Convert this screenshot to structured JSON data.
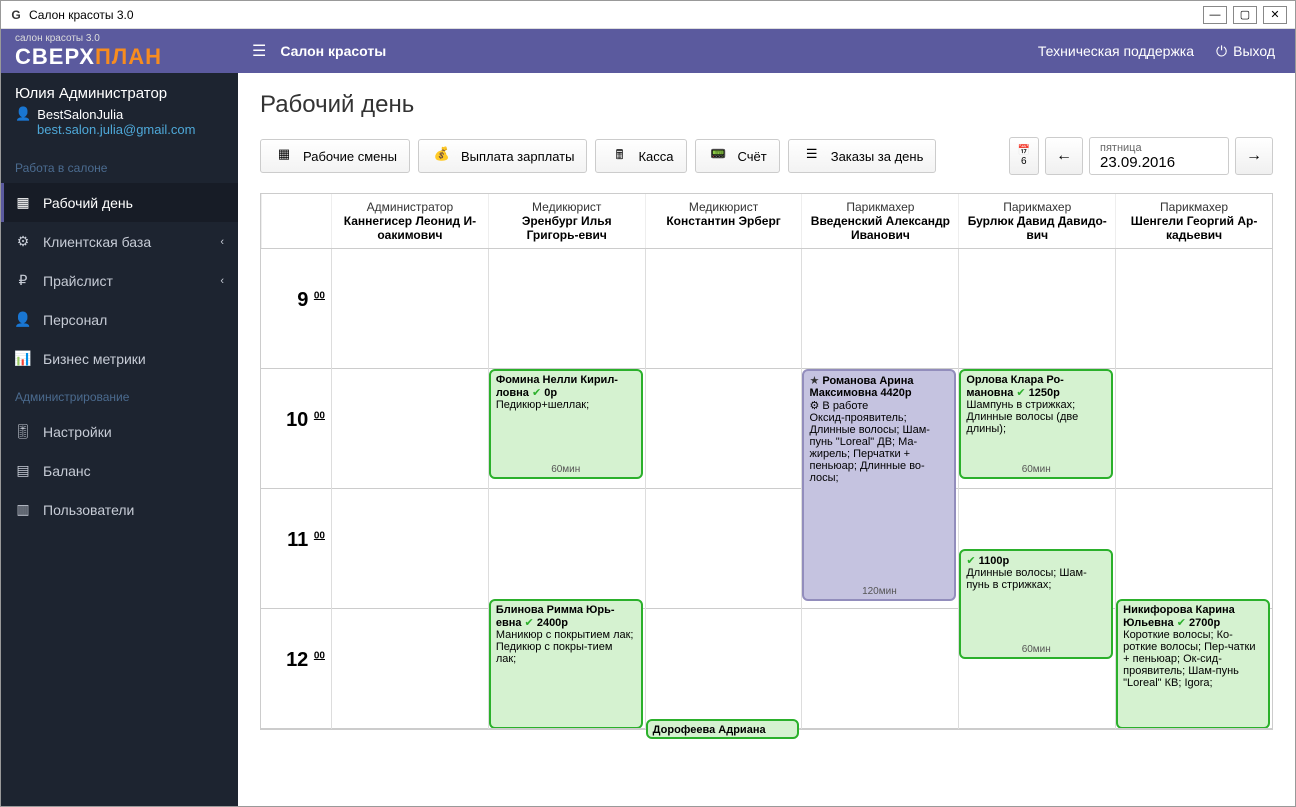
{
  "window": {
    "title": "Салон красоты 3.0"
  },
  "topbar": {
    "logo_top": "салон красоты 3.0",
    "logo_a": "СВЕРХ",
    "logo_b": "ПЛАН",
    "title": "Салон красоты",
    "support": "Техническая поддержка",
    "logout": "Выход"
  },
  "user": {
    "name": "Юлия Администратор",
    "salon": "BestSalonJulia",
    "email": "best.salon.julia@gmail.com"
  },
  "sidebar": {
    "section1": "Работа в салоне",
    "section2": "Администрирование",
    "items": [
      {
        "label": "Рабочий день"
      },
      {
        "label": "Клиентская база"
      },
      {
        "label": "Прайслист"
      },
      {
        "label": "Персонал"
      },
      {
        "label": "Бизнес метрики"
      },
      {
        "label": "Настройки"
      },
      {
        "label": "Баланс"
      },
      {
        "label": "Пользователи"
      }
    ]
  },
  "page": {
    "title": "Рабочий день"
  },
  "toolbar": {
    "shifts": "Рабочие смены",
    "payroll": "Выплата зарплаты",
    "cashier": "Касса",
    "invoice": "Счёт",
    "orders": "Заказы за день"
  },
  "date": {
    "day": "6",
    "dow": "пятница",
    "value": "23.09.2016"
  },
  "staff": [
    {
      "role": "Администратор",
      "name": "Каннегисер Леонид И-оакимович"
    },
    {
      "role": "Медикюрист",
      "name": "Эренбург Илья Григорь-евич"
    },
    {
      "role": "Медикюрист",
      "name": "Константин Эрберг"
    },
    {
      "role": "Парикмахер",
      "name": "Введенский Александр Иванович"
    },
    {
      "role": "Парикмахер",
      "name": "Бурлюк Давид Давидо-вич"
    },
    {
      "role": "Парикмахер",
      "name": "Шенгели Георгий Ар-кадьевич"
    }
  ],
  "hours": [
    "9",
    "10",
    "11",
    "12"
  ],
  "min_suffix": "00",
  "appts": {
    "fomina": {
      "client": "Фомина Нелли Кирил-ловна",
      "price": "0р",
      "services": "Педикюр+шеллак;",
      "duration": "60мин"
    },
    "romanova": {
      "client": "Романова Арина Максимовна",
      "price": "4420р",
      "status": "В работе",
      "services": "Оксид-проявитель; Длинные волосы; Шам-пунь \"Loreal\" ДВ; Ма-жирель; Перчатки + пеньюар; Длинные во-лосы;",
      "duration": "120мин"
    },
    "orlova": {
      "client": "Орлова Клара Ро-мановна",
      "price": "1250р",
      "services": "Шампунь в стрижках; Длинные волосы (две длины);",
      "duration": "60мин"
    },
    "anon": {
      "price": "1100р",
      "services": "Длинные волосы; Шам-пунь в стрижках;",
      "duration": "60мин"
    },
    "blinova": {
      "client": "Блинова Римма Юрь-евна",
      "price": "2400р",
      "services": "Маникюр с покрытием лак; Педикюр с покры-тием лак;",
      "duration": ""
    },
    "nikiforova": {
      "client": "Никифорова Карина Юльевна",
      "price": "2700р",
      "services": "Короткие волосы; Ко-роткие волосы; Пер-чатки + пеньюар; Ок-сид-проявитель; Шам-пунь \"Loreal\" КВ; Igora;",
      "duration": ""
    },
    "dorofeeva": {
      "client": "Дорофеева Адриана"
    }
  }
}
